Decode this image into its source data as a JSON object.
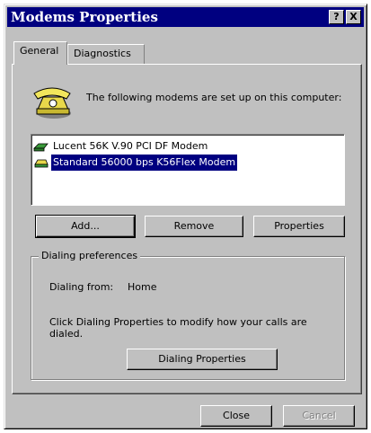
{
  "window": {
    "title": "Modems Properties",
    "help_button": "?",
    "close_button": "X"
  },
  "tabs": [
    {
      "label": "General",
      "active": true
    },
    {
      "label": "Diagnostics",
      "active": false
    }
  ],
  "general": {
    "intro_text": "The following modems are set up on this computer:",
    "modems": [
      {
        "name": "Lucent 56K V.90 PCI DF Modem",
        "selected": false
      },
      {
        "name": "Standard 56000 bps K56Flex Modem",
        "selected": true
      }
    ],
    "buttons": {
      "add": "Add...",
      "remove": "Remove",
      "properties": "Properties"
    },
    "dialing": {
      "group_label": "Dialing preferences",
      "from_label": "Dialing from:",
      "from_value": "Home",
      "help_text": "Click Dialing Properties to modify how your calls are dialed.",
      "button": "Dialing Properties"
    }
  },
  "footer": {
    "close": "Close",
    "cancel": "Cancel"
  },
  "colors": {
    "face": "#c0c0c0",
    "titlebar": "#000080",
    "selection": "#000080"
  }
}
